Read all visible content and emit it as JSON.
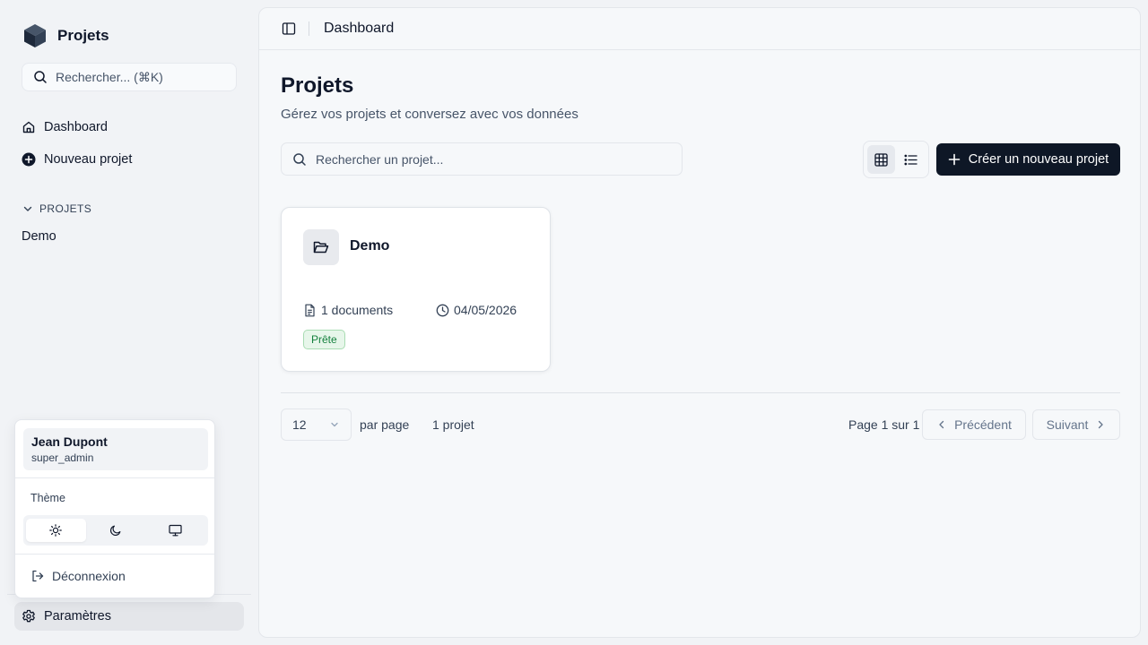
{
  "sidebar": {
    "brand": {
      "title": "Projets",
      "icon": "cube-icon"
    },
    "search": {
      "placeholder": "Rechercher... (⌘K)"
    },
    "nav": [
      {
        "label": "Dashboard",
        "icon": "home-icon"
      },
      {
        "label": "Nouveau projet",
        "icon": "plus-circle-icon"
      }
    ],
    "section": {
      "label": "PROJETS",
      "items": [
        "Demo"
      ]
    },
    "settings": {
      "label": "Paramètres",
      "icon": "gear-icon"
    }
  },
  "user_menu": {
    "name": "Jean Dupont",
    "role": "super_admin",
    "theme_label": "Thème",
    "theme_options": [
      {
        "name": "light",
        "icon": "sun-icon",
        "active": true
      },
      {
        "name": "dark",
        "icon": "moon-icon",
        "active": false
      },
      {
        "name": "system",
        "icon": "monitor-icon",
        "active": false
      }
    ],
    "logout_label": "Déconnexion"
  },
  "header": {
    "breadcrumb": "Dashboard"
  },
  "main": {
    "title": "Projets",
    "subtitle": "Gérez vos projets et conversez avec vos données",
    "search": {
      "placeholder": "Rechercher un projet..."
    },
    "view_mode": "grid",
    "create_button": "Créer un nouveau projet",
    "projects": [
      {
        "name": "Demo",
        "documents": "1 documents",
        "date": "04/05/2026",
        "status": "Prête",
        "status_color": "#15803d"
      }
    ],
    "pagination": {
      "per_page": "12",
      "per_page_label": "par page",
      "count": "1 projet",
      "page_info": "Page 1 sur 1",
      "prev_label": "Précédent",
      "next_label": "Suivant"
    }
  },
  "colors": {
    "primary_button": "#0e1726",
    "background": "#f1f3f6",
    "status_green": "#15803d"
  }
}
